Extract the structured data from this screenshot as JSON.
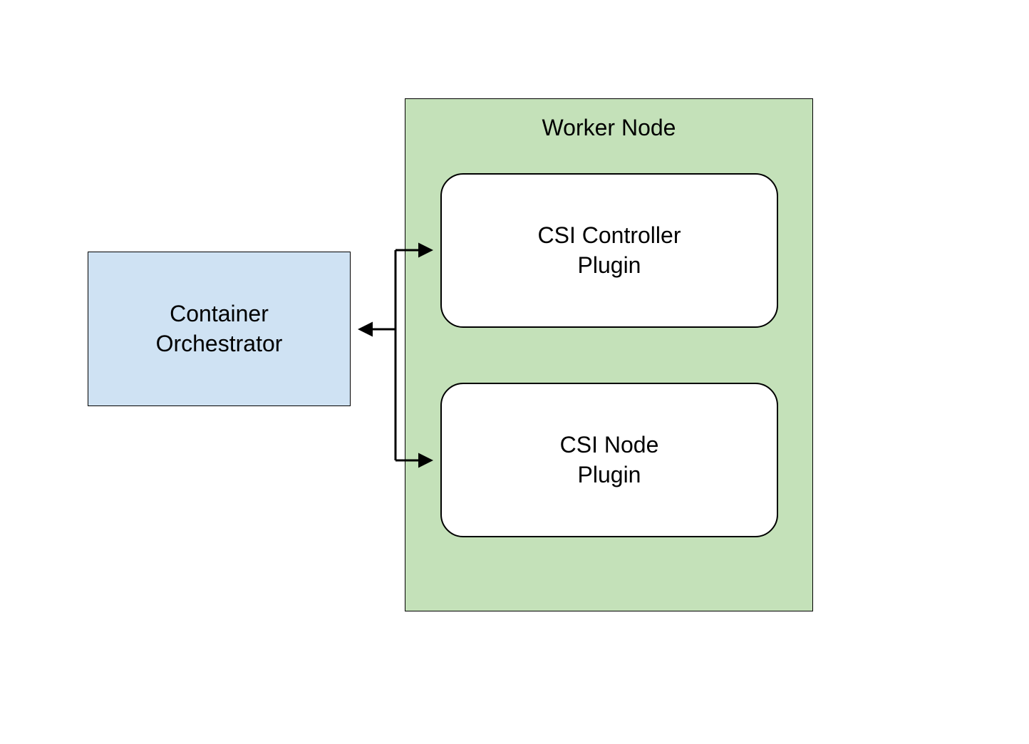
{
  "diagram": {
    "orchestrator": {
      "line1": "Container",
      "line2": "Orchestrator"
    },
    "worker_node": {
      "title": "Worker Node"
    },
    "controller_plugin": {
      "line1": "CSI Controller",
      "line2": "Plugin"
    },
    "node_plugin": {
      "line1": "CSI Node",
      "line2": "Plugin"
    }
  },
  "colors": {
    "orchestrator_bg": "#cfe2f3",
    "worker_bg": "#c4e1b9",
    "plugin_bg": "#ffffff",
    "border": "#000000"
  }
}
